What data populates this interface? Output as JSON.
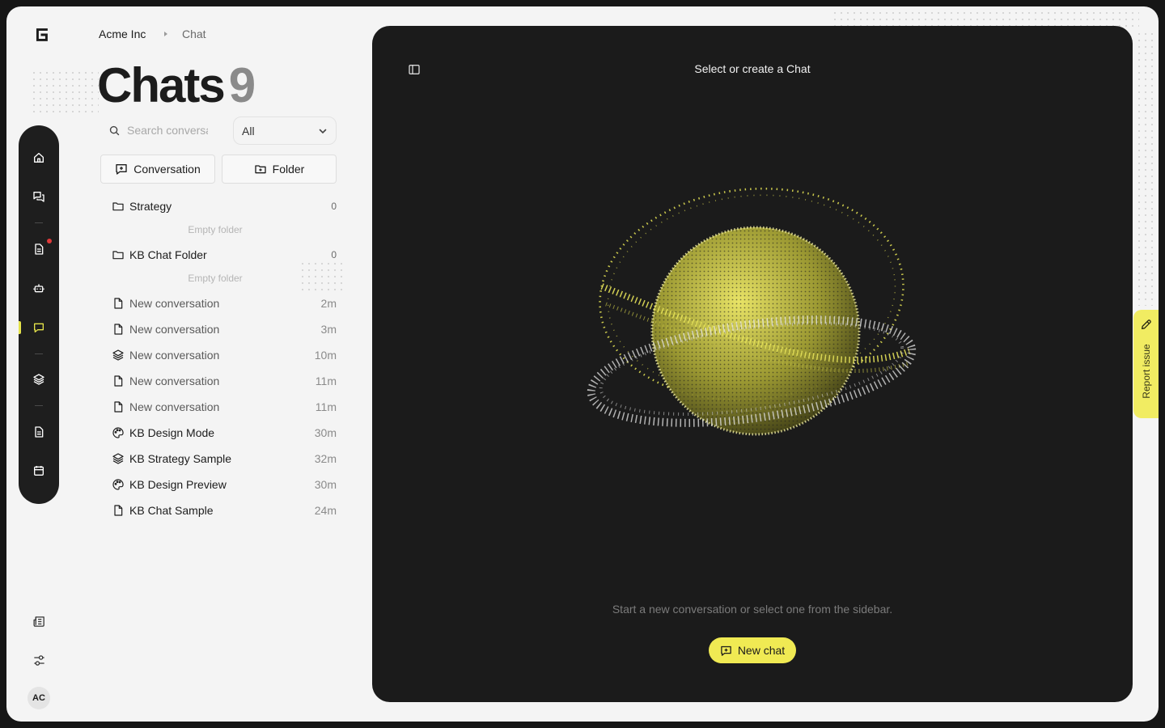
{
  "breadcrumb": {
    "org": "Acme Inc",
    "current": "Chat"
  },
  "page": {
    "title": "Chats",
    "count": "9"
  },
  "search": {
    "placeholder": "Search conversations"
  },
  "filter": {
    "selected": "All"
  },
  "actions": {
    "conversation": "Conversation",
    "folder": "Folder"
  },
  "folders": [
    {
      "name": "Strategy",
      "count": "0",
      "empty_label": "Empty folder"
    },
    {
      "name": "KB Chat Folder",
      "count": "0",
      "empty_label": "Empty folder"
    }
  ],
  "conversations": [
    {
      "title": "New conversation",
      "time": "2m",
      "icon": "file-icon"
    },
    {
      "title": "New conversation",
      "time": "3m",
      "icon": "file-icon"
    },
    {
      "title": "New conversation",
      "time": "10m",
      "icon": "layers-icon"
    },
    {
      "title": "New conversation",
      "time": "11m",
      "icon": "file-icon"
    },
    {
      "title": "New conversation",
      "time": "11m",
      "icon": "file-icon"
    },
    {
      "title": "KB Design Mode",
      "time": "30m",
      "icon": "palette-icon"
    },
    {
      "title": "KB Strategy Sample",
      "time": "32m",
      "icon": "layers-icon"
    },
    {
      "title": "KB Design Preview",
      "time": "30m",
      "icon": "palette-icon"
    },
    {
      "title": "KB Chat Sample",
      "time": "24m",
      "icon": "file-icon"
    }
  ],
  "rail": [
    "home-icon",
    "chats-icon",
    "document-icon",
    "bot-icon",
    "chat-bubble-icon",
    "layers-icon",
    "file-text-icon",
    "calendar-icon"
  ],
  "user": {
    "initials": "AC"
  },
  "chat_panel": {
    "header": "Select or create a Chat",
    "hint": "Start a new conversation or select one from the sidebar.",
    "new_chat_label": "New chat"
  },
  "report": {
    "label": "Report issue"
  },
  "colors": {
    "accent": "#f0ea53",
    "panel": "#1b1b1b",
    "background": "#f4f4f4",
    "notification": "#e03a3a"
  }
}
